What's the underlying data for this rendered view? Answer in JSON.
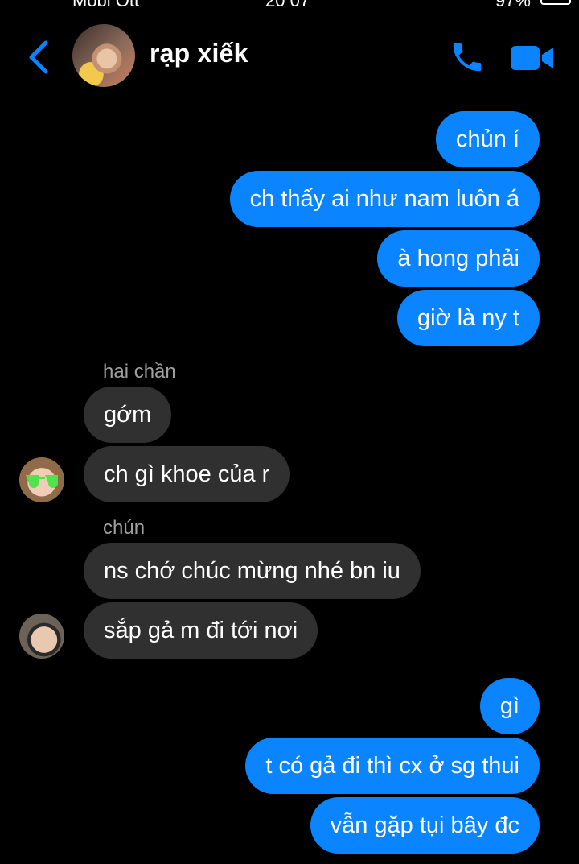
{
  "statusbar": {
    "left": "Mobi Ott",
    "center": "20 07",
    "right": "97%"
  },
  "header": {
    "title": "rạp xiếk"
  },
  "messages": [
    {
      "text": "chủn í",
      "side": "out"
    },
    {
      "text": "ch thấy ai như nam luôn á",
      "side": "out"
    },
    {
      "text": "à hong phải",
      "side": "out"
    },
    {
      "text": "giờ là ny t",
      "side": "out"
    },
    {
      "text": "gớm",
      "side": "in"
    },
    {
      "text": "ch gì khoe của r",
      "side": "in"
    },
    {
      "text": "ns chớ chúc mừng nhé bn iu",
      "side": "in"
    },
    {
      "text": "sắp gả m đi tới nơi",
      "side": "in"
    },
    {
      "text": "gì",
      "side": "out"
    },
    {
      "text": "t có gả đi thì cx ở sg thui",
      "side": "out"
    },
    {
      "text": "vẫn gặp tụi bây đc",
      "side": "out"
    }
  ],
  "senders": [
    "hai chần",
    "chún"
  ],
  "colors": {
    "accent": "#0a84ff",
    "incoming_bubble": "#303030",
    "background": "#000000"
  }
}
